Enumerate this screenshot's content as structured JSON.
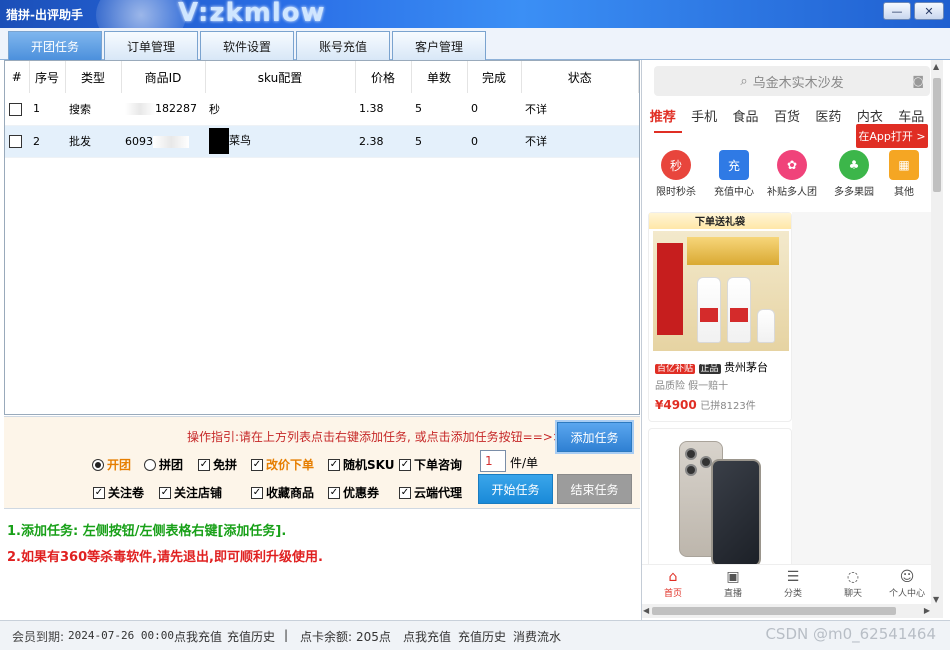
{
  "window": {
    "title": "猎拼-出评助手",
    "watermark": "V:zkmlow",
    "minimize_label": "—",
    "close_label": "✕"
  },
  "tabs": [
    {
      "label": "开团任务",
      "active": true
    },
    {
      "label": "订单管理",
      "active": false
    },
    {
      "label": "软件设置",
      "active": false
    },
    {
      "label": "账号充值",
      "active": false
    },
    {
      "label": "客户管理",
      "active": false
    }
  ],
  "table": {
    "headers": [
      "#",
      "序号",
      "类型",
      "商品ID",
      "sku配置",
      "价格",
      "单数",
      "完成",
      "状态"
    ],
    "rows": [
      {
        "index": "1",
        "type": "搜索",
        "product_id": "182287",
        "sku": "秒",
        "price": "1.38",
        "count": "5",
        "done": "0",
        "status": "不详"
      },
      {
        "index": "2",
        "type": "批发",
        "product_id": "6093",
        "sku": "菜鸟",
        "price": "2.38",
        "count": "5",
        "done": "0",
        "status": "不详"
      }
    ]
  },
  "control": {
    "guide": "操作指引:请在上方列表点击右键添加任务, 或点击添加任务按钮==>>",
    "add_task": "添加任务",
    "start_task": "开始任务",
    "end_task": "结束任务",
    "radio_open": "开团",
    "radio_join": "拼团",
    "opt_free": "免拼",
    "opt_change_price": "改价下单",
    "opt_random_sku": "随机SKU",
    "opt_consult": "下单咨询",
    "qty_value": "1",
    "qty_unit": "件/单",
    "opt_follow_coupon": "关注卷",
    "opt_follow_shop": "关注店铺",
    "opt_collect": "收藏商品",
    "opt_coupon": "优惠券",
    "opt_cloud_proxy": "云端代理"
  },
  "info": {
    "line1": "1.添加任务: 左侧按钮/左侧表格右键[添加任务].",
    "line2": "2.如果有360等杀毒软件,请先退出,即可顺利升级使用."
  },
  "phone": {
    "search_placeholder": "乌金木实木沙发",
    "categories": [
      "推荐",
      "手机",
      "食品",
      "百货",
      "医药",
      "内衣",
      "车品"
    ],
    "app_open": "在App打开 >",
    "icons": [
      {
        "label": "限时秒杀",
        "glyph": "秒"
      },
      {
        "label": "充值中心",
        "glyph": "充"
      },
      {
        "label": "补贴多人团",
        "glyph": "✿"
      },
      {
        "label": "多多果园",
        "glyph": "♣"
      },
      {
        "label": "其他",
        "glyph": "▦"
      }
    ],
    "card1": {
      "promo": "下单送礼袋",
      "tag1": "百亿补贴",
      "tag2": "正品",
      "name": "贵州茅台",
      "guarantee": "品质险  假一赔十",
      "price": "¥4900",
      "sold": "已拼8123件"
    },
    "nav": [
      "首页",
      "直播",
      "分类",
      "聊天",
      "个人中心"
    ]
  },
  "status": {
    "member_label": "会员到期:",
    "member_date": "2024-07-26 00:00",
    "recharge1": "点我充值",
    "history1": "充值历史",
    "sep": "|",
    "balance_label": "点卡余额:",
    "balance_value": "205点",
    "recharge2": "点我充值",
    "history2": "充值历史",
    "consume": "消费流水",
    "csdn": "CSDN @m0_62541464"
  }
}
